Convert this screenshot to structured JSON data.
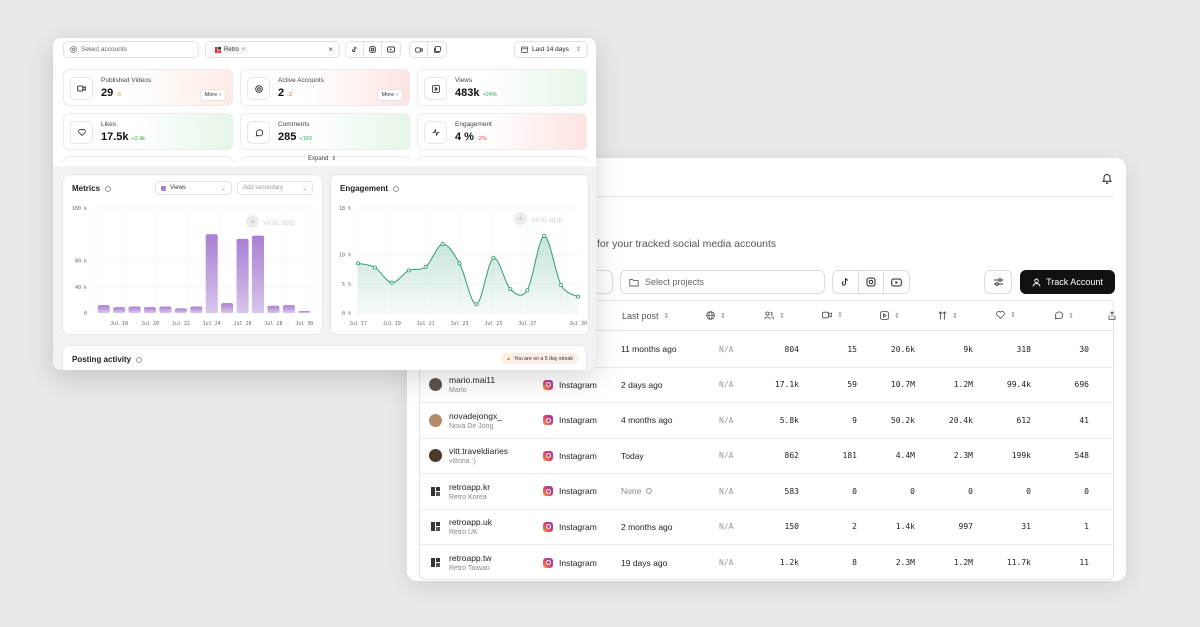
{
  "back": {
    "subtitle": "for your tracked social media accounts",
    "projects_placeholder": "Select projects",
    "track_button": "Track Account",
    "headers": {
      "last_post": "Last post"
    },
    "rows": [
      {
        "handle": "",
        "name": "",
        "avatar": "#c9b9a6",
        "platform": "",
        "last_post": "11 months ago",
        "na": "N/A",
        "followers": "804",
        "videos": "15",
        "views": "20.6k",
        "shares": "9k",
        "likes": "318",
        "comments": "30"
      },
      {
        "handle": "mario.mai11",
        "name": "Mario",
        "avatar": "#5a5550",
        "platform": "Instagram",
        "last_post": "2 days ago",
        "na": "N/A",
        "followers": "17.1k",
        "videos": "59",
        "views": "10.7M",
        "shares": "1.2M",
        "likes": "99.4k",
        "comments": "696"
      },
      {
        "handle": "novadejongx_",
        "name": "Nova De Jong",
        "avatar": "#b48a6a",
        "platform": "Instagram",
        "last_post": "4 months ago",
        "na": "N/A",
        "followers": "5.8k",
        "videos": "9",
        "views": "50.2k",
        "shares": "20.4k",
        "likes": "612",
        "comments": "41"
      },
      {
        "handle": "vitt.traveldiaries",
        "name": "vittoria :)",
        "avatar": "#4b3a2c",
        "platform": "Instagram",
        "last_post": "Today",
        "na": "N/A",
        "followers": "862",
        "videos": "181",
        "views": "4.4M",
        "shares": "2.3M",
        "likes": "199k",
        "comments": "548"
      },
      {
        "handle": "retroapp.kr",
        "name": "Retro Korea",
        "avatar": "logo",
        "platform": "Instagram",
        "last_post": "None",
        "na": "N/A",
        "followers": "583",
        "videos": "0",
        "views": "0",
        "shares": "0",
        "likes": "0",
        "comments": "0"
      },
      {
        "handle": "retroapp.uk",
        "name": "Retro UK",
        "avatar": "logo",
        "platform": "Instagram",
        "last_post": "2 months ago",
        "na": "N/A",
        "followers": "150",
        "videos": "2",
        "views": "1.4k",
        "shares": "997",
        "likes": "31",
        "comments": "1"
      },
      {
        "handle": "retroapp.tw",
        "name": "Retro Taiwan",
        "avatar": "logo",
        "platform": "Instagram",
        "last_post": "19 days ago",
        "na": "N/A",
        "followers": "1.2k",
        "videos": "8",
        "views": "2.3M",
        "shares": "1.2M",
        "likes": "11.7k",
        "comments": "11"
      }
    ]
  },
  "front": {
    "select_accounts": "Select accounts",
    "tag": "Retro",
    "date_range": "Last 14 days",
    "kpis": [
      {
        "label": "Published Videos",
        "value": "29",
        "delta": "-5",
        "delta_kind": "orange",
        "more": "More",
        "tint": "orange"
      },
      {
        "label": "Active Accounts",
        "value": "2",
        "delta": "-2",
        "delta_kind": "neg",
        "more": "More",
        "tint": "red"
      },
      {
        "label": "Views",
        "value": "483k",
        "delta": "+24%",
        "delta_kind": "pos",
        "more": "",
        "tint": "green"
      },
      {
        "label": "Likes",
        "value": "17.5k",
        "delta": "+2.9k",
        "delta_kind": "pos",
        "more": "",
        "tint": "green"
      },
      {
        "label": "Comments",
        "value": "285",
        "delta": "+103",
        "delta_kind": "pos",
        "more": "",
        "tint": "green"
      },
      {
        "label": "Engagement",
        "value": "4 %",
        "delta": "-2%",
        "delta_kind": "neg",
        "more": "",
        "tint": "red"
      }
    ],
    "expand": "Expand",
    "metrics_title": "Metrics",
    "metric_primary": "Views",
    "metric_secondary": "Add secondary",
    "engagement_title": "Engagement",
    "watermark": "viral.app",
    "posting_title": "Posting activity",
    "streak": "You are on a 5 day streak"
  },
  "chart_data": [
    {
      "type": "bar",
      "title": "Metrics",
      "series": [
        {
          "name": "Views",
          "values": [
            12,
            9,
            10,
            9,
            10,
            7,
            10,
            120,
            15,
            113,
            118,
            11,
            12,
            3
          ]
        }
      ],
      "x_ticks": [
        "Jul 18",
        "Jul 20",
        "Jul 22",
        "Jul 24",
        "Jul 26",
        "Jul 28",
        "Jul 30"
      ],
      "y_ticks": [
        "0",
        "40 k",
        "80 k",
        "160 k"
      ],
      "ylim": [
        0,
        160
      ]
    },
    {
      "type": "area",
      "title": "Engagement",
      "values": [
        8.5,
        7.8,
        5.2,
        7.3,
        7.9,
        11.8,
        8.5,
        1.5,
        9.4,
        4.1,
        3.9,
        13.2,
        4.8,
        2.8
      ],
      "x_ticks": [
        "Jul 17",
        "Jul 19",
        "Jul 21",
        "Jul 23",
        "Jul 25",
        "Jul 27",
        "Jul 30"
      ],
      "y_ticks": [
        "0 %",
        "5 %",
        "10 %",
        "18 %"
      ],
      "ylim": [
        0,
        18
      ]
    }
  ]
}
